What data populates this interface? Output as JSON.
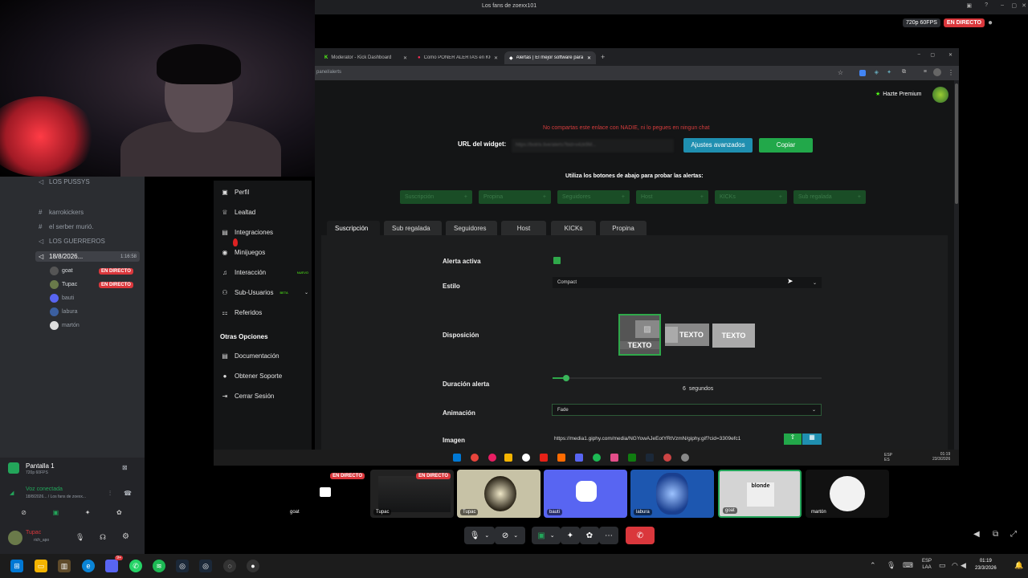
{
  "discord_window": {
    "title": "Los fans de zoexx101",
    "stream_quality": "720p 60FPS",
    "live_label": "EN DIRECTO"
  },
  "discord_sidebar": {
    "channels": [
      "LOS PUSSYS",
      "karrokickers",
      "el serber murió.",
      "LOS GUERREROS"
    ],
    "voice_channel": {
      "name": "18/8/2026...",
      "timer": "1:16:58"
    },
    "voice_users": [
      {
        "name": "goat",
        "live": true
      },
      {
        "name": "Tupac",
        "live": true
      },
      {
        "name": "bauti",
        "live": false
      },
      {
        "name": "labura",
        "live": false
      },
      {
        "name": "martón",
        "live": false
      }
    ],
    "screen_share": {
      "title": "Pantalla 1",
      "quality": "720p 60FPS"
    },
    "voice_status": {
      "label": "Voz conectada",
      "detail": "18/8/2026... / Los fans de zoexx..."
    },
    "user_panel": {
      "name": "Tupac",
      "status": "rich_apo"
    }
  },
  "browser": {
    "tabs": [
      {
        "label": "Moderator - Kick Dashboard",
        "active": false
      },
      {
        "label": "Como PONER ALERTAS en KICK",
        "active": false
      },
      {
        "label": "Alertas | El mejor software para",
        "active": true
      }
    ],
    "url": "panel/alerts"
  },
  "app": {
    "premium_label": "Hazte Premium",
    "warning": "No compartas este enlace con NADIE, ni lo pegues en ningun chat",
    "widget_label": "URL del widget:",
    "widget_url": "https://botrix.live/alerts?bid=x4zk9M...",
    "advanced_button": "Ajustes avanzados",
    "copy_button": "Copiar",
    "test_hint": "Utiliza los botones de abajo para probar las alertas:",
    "test_buttons": [
      "Suscripción",
      "Propina",
      "Seguidores",
      "Host",
      "KICKs",
      "Sub regalada"
    ],
    "sidebar_items": [
      {
        "label": "Perfil",
        "icon": "user-icon"
      },
      {
        "label": "Lealtad",
        "icon": "trophy-icon"
      },
      {
        "label": "Integraciones",
        "icon": "puzzle-icon"
      },
      {
        "label": "Minijuegos",
        "icon": "gamepad-icon"
      },
      {
        "label": "Interacción",
        "icon": "music-icon",
        "badge": "NUEVO"
      },
      {
        "label": "Sub-Usuarios",
        "icon": "users-icon",
        "badge": "BETA"
      },
      {
        "label": "Referidos",
        "icon": "referral-icon"
      }
    ],
    "other_options_heading": "Otras Opciones",
    "other_items": [
      {
        "label": "Documentación",
        "icon": "book-icon"
      },
      {
        "label": "Obtener Soporte",
        "icon": "help-icon"
      },
      {
        "label": "Cerrar Sesión",
        "icon": "logout-icon"
      }
    ],
    "alert_tabs": [
      "Suscripción",
      "Sub regalada",
      "Seguidores",
      "Host",
      "KICKs",
      "Propina"
    ],
    "form": {
      "active_label": "Alerta activa",
      "style_label": "Estilo",
      "style_value": "Compact",
      "layout_label": "Disposición",
      "layout_option_text": "TEXTO",
      "duration_label": "Duración alerta",
      "duration_value": "6",
      "duration_unit": "segundos",
      "duration_fraction": 0.04,
      "animation_label": "Animación",
      "animation_value": "Fade",
      "image_label": "Imagen",
      "image_value": "https://media1.giphy.com/media/NGYowAJeEotYRtVzmN/giphy.gif?cid=3309efc1"
    },
    "footer_user": "goat"
  },
  "inner_taskbar": {
    "lang": "ESP ES",
    "time": "01:19",
    "date": "23/3/2026"
  },
  "tiles": [
    {
      "name": "goat",
      "live": true
    },
    {
      "name": "Tupac",
      "live": true
    },
    {
      "name": "Tupac",
      "live": false
    },
    {
      "name": "bauti",
      "live": false
    },
    {
      "name": "labura",
      "live": false
    },
    {
      "name": "goat",
      "live": false
    },
    {
      "name": "martón",
      "live": false
    }
  ],
  "tile_art_text": "blonde",
  "windows_taskbar": {
    "lang": "ESP",
    "lang_sub": "LAA",
    "time": "01:19",
    "date": "23/3/2026",
    "discord_badge": "9+"
  },
  "colors": {
    "kick_green": "#53fc18",
    "live_red": "#da373c",
    "discord_blurple": "#5865f2"
  }
}
